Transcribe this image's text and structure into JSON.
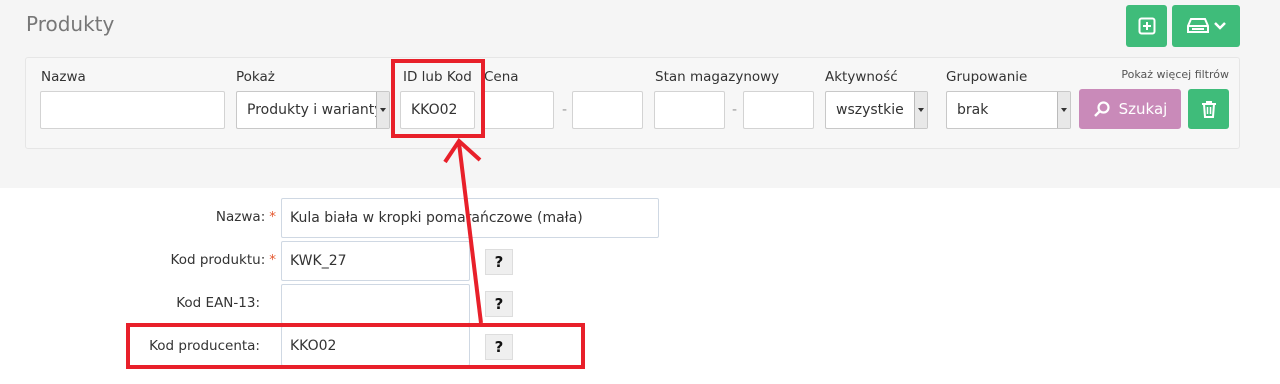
{
  "page": {
    "title": "Produkty"
  },
  "toolbar": {
    "add_icon": "plus-square-icon",
    "export_icon": "printer-icon",
    "dropdown_icon": "chevron-down-icon"
  },
  "filters": {
    "nazwa_label": "Nazwa",
    "pokaz_label": "Pokaż",
    "pokaz_value": "Produkty i warianty",
    "id_label": "ID lub Kod",
    "id_value": "KKO02",
    "cena_label": "Cena",
    "cena_sep": "-",
    "stan_label": "Stan magazynowy",
    "stan_sep": "-",
    "aktywnosc_label": "Aktywność",
    "aktywnosc_value": "wszystkie",
    "grupowanie_label": "Grupowanie",
    "grupowanie_value": "brak",
    "more_filters": "Pokaż więcej filtrów",
    "search_label": "Szukaj"
  },
  "form": {
    "nazwa_label": "Nazwa:",
    "nazwa_value": "Kula biała w kropki pomarańczowe (mała)",
    "kod_label": "Kod produktu:",
    "kod_value": "KWK_27",
    "ean_label": "Kod EAN-13:",
    "ean_value": "",
    "producenta_label": "Kod producenta:",
    "producenta_value": "KKO02",
    "required_mark": "*",
    "help_mark": "?"
  },
  "colors": {
    "accent_green": "#3fbc7a",
    "search_purple": "#c98ab9",
    "highlight_red": "#e8202a",
    "required": "#e4572e"
  }
}
